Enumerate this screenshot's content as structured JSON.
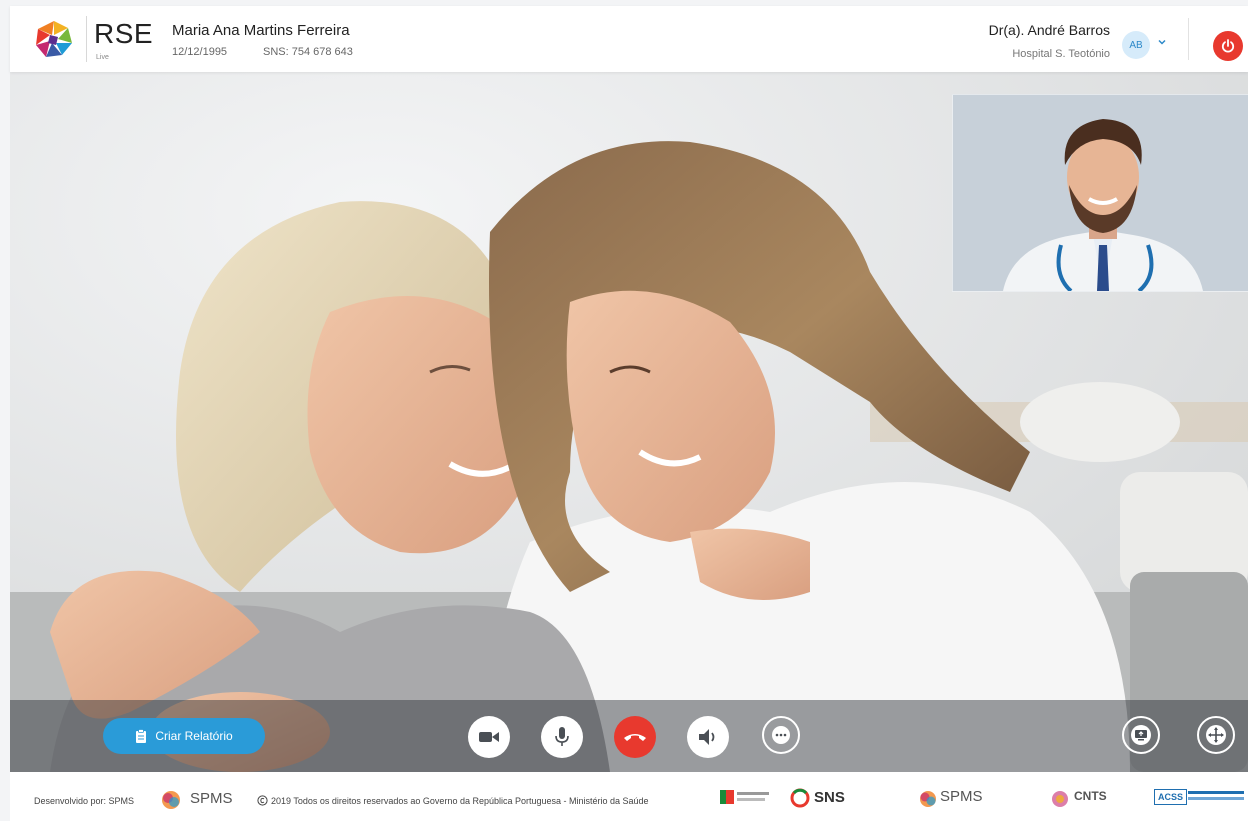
{
  "header": {
    "logo_text": "RSE",
    "logo_sub": "Live",
    "patient": {
      "name": "Maria Ana Martins Ferreira",
      "dob": "12/12/1995",
      "sns": "SNS: 754 678 643"
    },
    "doctor": {
      "name": "Dr(a). André Barros",
      "hospital": "Hospital S. Teotónio",
      "initials": "AB"
    }
  },
  "controls": {
    "report_label": "Criar Relatório"
  },
  "footer": {
    "developed_by": "Desenvolvido por: SPMS",
    "spms": "SPMS",
    "copyright": "2019 Todos os direitos reservados ao Governo da República Portuguesa - Ministério da Saúde",
    "sns": "SNS",
    "spms2": "SPMS",
    "cnts": "CNTS",
    "acss": "ACSS"
  },
  "colors": {
    "accent": "#2a9bd8",
    "danger": "#e8392e"
  }
}
